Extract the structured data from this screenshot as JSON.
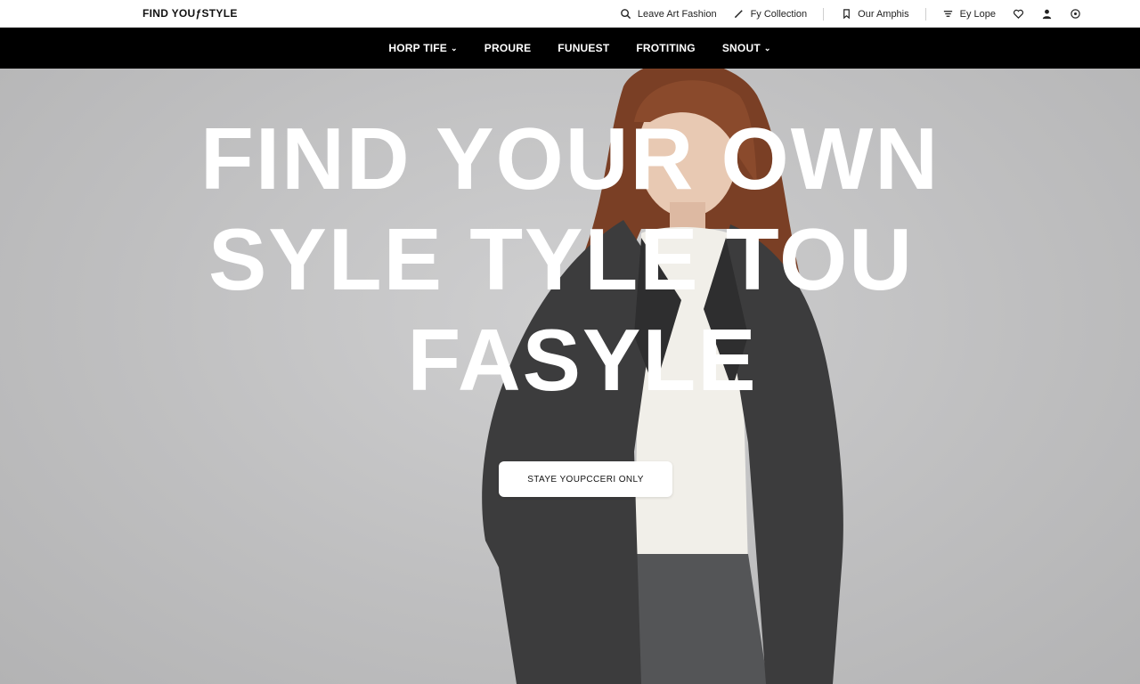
{
  "brand": {
    "logo_text": "FIND YOUƒSTYLE"
  },
  "utility_nav": [
    {
      "label": "Leave Art Fashion",
      "icon": "search-icon"
    },
    {
      "label": "Fy Collection",
      "icon": "pencil-icon"
    },
    {
      "label": "Our Amphis",
      "icon": "bookmark-icon"
    },
    {
      "label": "Ey Lope",
      "icon": "filter-icon"
    }
  ],
  "utility_icons": [
    "heart-icon",
    "user-icon",
    "cart-icon"
  ],
  "main_nav": [
    {
      "label": "HORP TIFE",
      "has_dropdown": true
    },
    {
      "label": "PROURE",
      "has_dropdown": false
    },
    {
      "label": "FUNUEST",
      "has_dropdown": false
    },
    {
      "label": "FROTITING",
      "has_dropdown": false
    },
    {
      "label": "SNOUT",
      "has_dropdown": true
    }
  ],
  "hero": {
    "headline_lines": [
      "FIND YOUR OWN",
      "SYLE TYLE TOU",
      "FASYLE"
    ],
    "cta_label": "STAYE YOUPCCERI ONLY"
  },
  "colors": {
    "nav_bg": "#000000",
    "hero_bg": "#c4c4c5",
    "headline": "#ffffff",
    "coat": "#3c3c3d",
    "sweater": "#f1efe9",
    "hair": "#7a3f25"
  }
}
